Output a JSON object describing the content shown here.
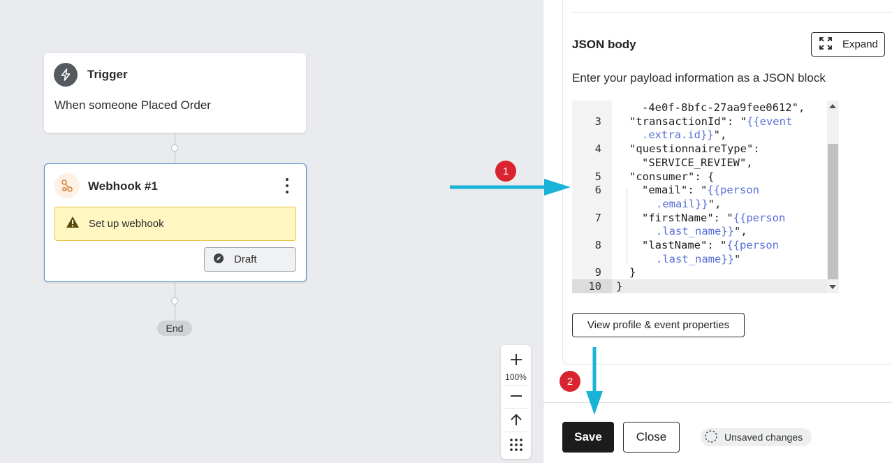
{
  "canvas": {
    "trigger": {
      "title": "Trigger",
      "subtitle": "When someone Placed Order"
    },
    "webhook": {
      "title": "Webhook #1",
      "warning": "Set up webhook",
      "draft_label": "Draft"
    },
    "end_label": "End",
    "zoom": {
      "level": "100%"
    }
  },
  "annotations": {
    "badge1": "1",
    "badge2": "2"
  },
  "panel": {
    "json_title": "JSON body",
    "expand_label": "Expand",
    "description": "Enter your payload information as a JSON block",
    "code_lines": [
      {
        "num": "",
        "parts": [
          {
            "t": "-4e0f-8bfc-27aa9fee0612\",",
            "c": ""
          }
        ]
      },
      {
        "num": "3",
        "parts": [
          {
            "t": "\"transactionId\": \"",
            "c": ""
          },
          {
            "t": "{{event",
            "c": "tpl"
          }
        ]
      },
      {
        "num": "",
        "parts": [
          {
            "t": ".extra.id}}",
            "c": "tpl"
          },
          {
            "t": "\",",
            "c": ""
          }
        ]
      },
      {
        "num": "4",
        "parts": [
          {
            "t": "\"questionnaireType\":",
            "c": ""
          }
        ]
      },
      {
        "num": "",
        "parts": [
          {
            "t": "\"SERVICE_REVIEW\",",
            "c": ""
          }
        ]
      },
      {
        "num": "5",
        "parts": [
          {
            "t": "\"consumer\": {",
            "c": ""
          }
        ]
      },
      {
        "num": "6",
        "parts": [
          {
            "t": "\"email\": \"",
            "c": ""
          },
          {
            "t": "{{person",
            "c": "tpl"
          }
        ]
      },
      {
        "num": "",
        "parts": [
          {
            "t": ".email}}",
            "c": "tpl"
          },
          {
            "t": "\",",
            "c": ""
          }
        ]
      },
      {
        "num": "7",
        "parts": [
          {
            "t": "\"firstName\": \"",
            "c": ""
          },
          {
            "t": "{{person",
            "c": "tpl"
          }
        ]
      },
      {
        "num": "",
        "parts": [
          {
            "t": ".last_name}}",
            "c": "tpl"
          },
          {
            "t": "\",",
            "c": ""
          }
        ]
      },
      {
        "num": "8",
        "parts": [
          {
            "t": "\"lastName\": \"",
            "c": ""
          },
          {
            "t": "{{person",
            "c": "tpl"
          }
        ]
      },
      {
        "num": "",
        "parts": [
          {
            "t": ".last_name}}",
            "c": "tpl"
          },
          {
            "t": "\"",
            "c": ""
          }
        ]
      },
      {
        "num": "9",
        "parts": [
          {
            "t": "}",
            "c": ""
          }
        ]
      },
      {
        "num": "10",
        "parts": [
          {
            "t": "}",
            "c": ""
          }
        ]
      }
    ],
    "view_props_label": "View profile & event properties",
    "footer": {
      "save_label": "Save",
      "close_label": "Close",
      "unsaved_label": "Unsaved changes"
    }
  },
  "colors": {
    "accent_blue": "#4a8fd4",
    "arrow_cyan": "#1ab3d8",
    "badge_red": "#d9232e",
    "warning_bg": "#fff6c2"
  },
  "icons": {
    "trigger": "lightning-icon",
    "webhook": "webhook-icon",
    "warning": "warning-triangle-icon",
    "draft": "compass-icon",
    "expand": "expand-arrows-icon",
    "zoom_in": "plus-icon",
    "zoom_out": "minus-icon",
    "fit": "arrow-up-icon",
    "grid": "grid-dots-icon",
    "unsaved": "dashed-circle-icon"
  }
}
